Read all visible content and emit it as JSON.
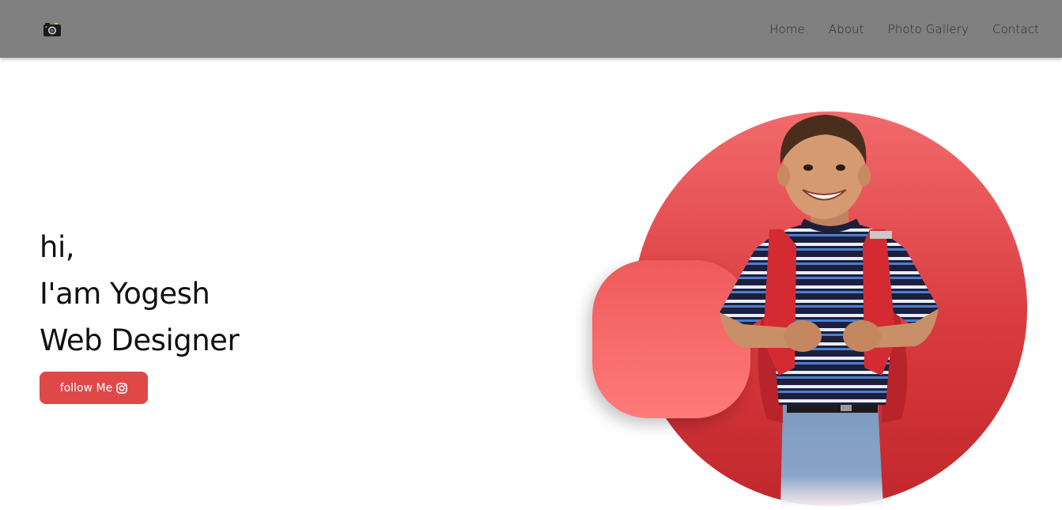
{
  "nav": {
    "logo_icon": "camera-icon",
    "links": [
      "Home",
      "About",
      "Photo Gallery",
      "Contact"
    ]
  },
  "hero": {
    "line1": "hi,",
    "line2": "I'am Yogesh",
    "line3": "Web Designer",
    "button_label": "follow Me",
    "button_icon": "instagram-icon"
  },
  "colors": {
    "navbar": "#808080",
    "accent": "#e04848",
    "circle": "#d93a3e",
    "blob": "#f56b6c"
  }
}
